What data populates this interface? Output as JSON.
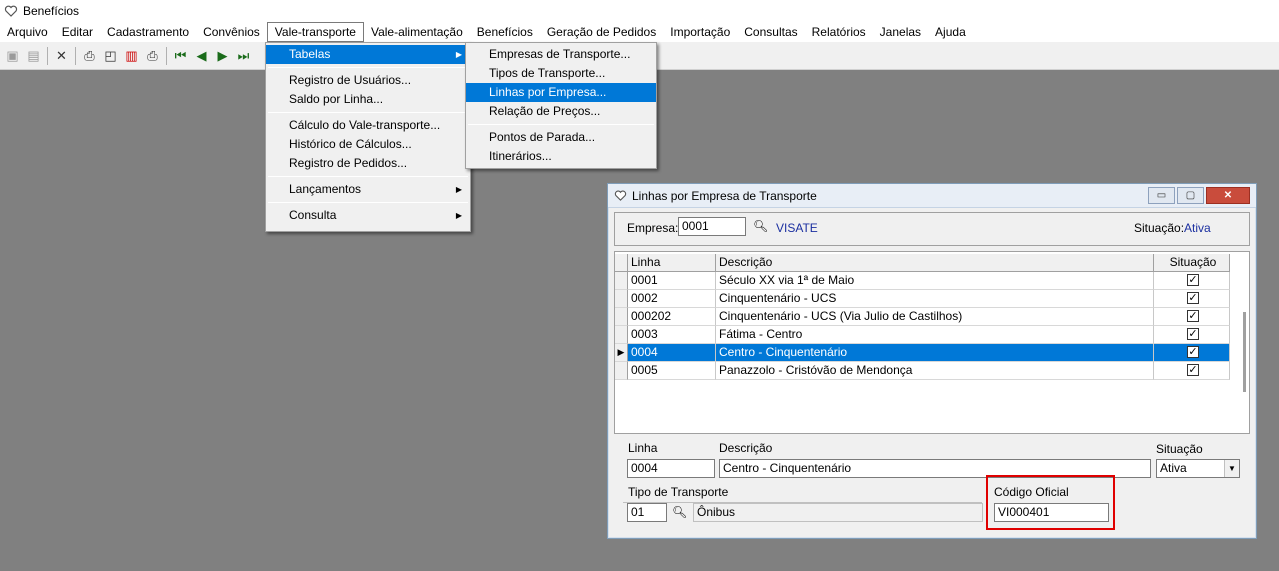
{
  "app": {
    "title": "Benefícios"
  },
  "menubar": [
    "Arquivo",
    "Editar",
    "Cadastramento",
    "Convênios",
    "Vale-transporte",
    "Vale-alimentação",
    "Benefícios",
    "Geração de Pedidos",
    "Importação",
    "Consultas",
    "Relatórios",
    "Janelas",
    "Ajuda"
  ],
  "vt_menu": {
    "tabelas": "Tabelas",
    "registro_usuarios": "Registro de Usuários...",
    "saldo_linha": "Saldo por Linha...",
    "calculo": "Cálculo do Vale-transporte...",
    "historico": "Histórico de Cálculos...",
    "registro_pedidos": "Registro de Pedidos...",
    "lancamentos": "Lançamentos",
    "consulta": "Consulta"
  },
  "tabelas_menu": {
    "empresas": "Empresas de Transporte...",
    "tipos": "Tipos de Transporte...",
    "linhas": "Linhas por Empresa...",
    "precos": "Relação de Preços...",
    "pontos": "Pontos de Parada...",
    "itinerarios": "Itinerários..."
  },
  "window": {
    "title": "Linhas por Empresa de Transporte",
    "empresa_label": "Empresa:",
    "empresa_code": "0001",
    "empresa_name": "VISATE",
    "situacao_label": "Situação:",
    "situacao_value": "Ativa",
    "grid": {
      "headers": [
        "Linha",
        "Descrição",
        "Situação"
      ],
      "rows": [
        {
          "linha": "0001",
          "descricao": "Século XX via 1ª de Maio",
          "checked": "✓"
        },
        {
          "linha": "0002",
          "descricao": "Cinquentenário - UCS",
          "checked": "✓"
        },
        {
          "linha": "000202",
          "descricao": "Cinquentenário - UCS (Via Julio de Castilhos)",
          "checked": "✓"
        },
        {
          "linha": "0003",
          "descricao": "Fátima - Centro",
          "checked": "✓"
        },
        {
          "linha": "0004",
          "descricao": "Centro - Cinquentenário",
          "checked": "✓"
        },
        {
          "linha": "0005",
          "descricao": "Panazzolo - Cristóvão de Mendonça",
          "checked": "✓"
        }
      ]
    },
    "form": {
      "linha_label": "Linha",
      "linha_value": "0004",
      "descricao_label": "Descrição",
      "descricao_value": "Centro - Cinquentenário",
      "situacao_label": "Situação",
      "situacao_value": "Ativa",
      "tipo_label": "Tipo de Transporte",
      "tipo_code": "01",
      "tipo_name": "Ônibus",
      "codigo_label": "Código Oficial",
      "codigo_value": "VI000401"
    }
  },
  "colors": {
    "highlight": "#0078d7",
    "annotation": "#e00000",
    "link": "#1b2fa0"
  }
}
